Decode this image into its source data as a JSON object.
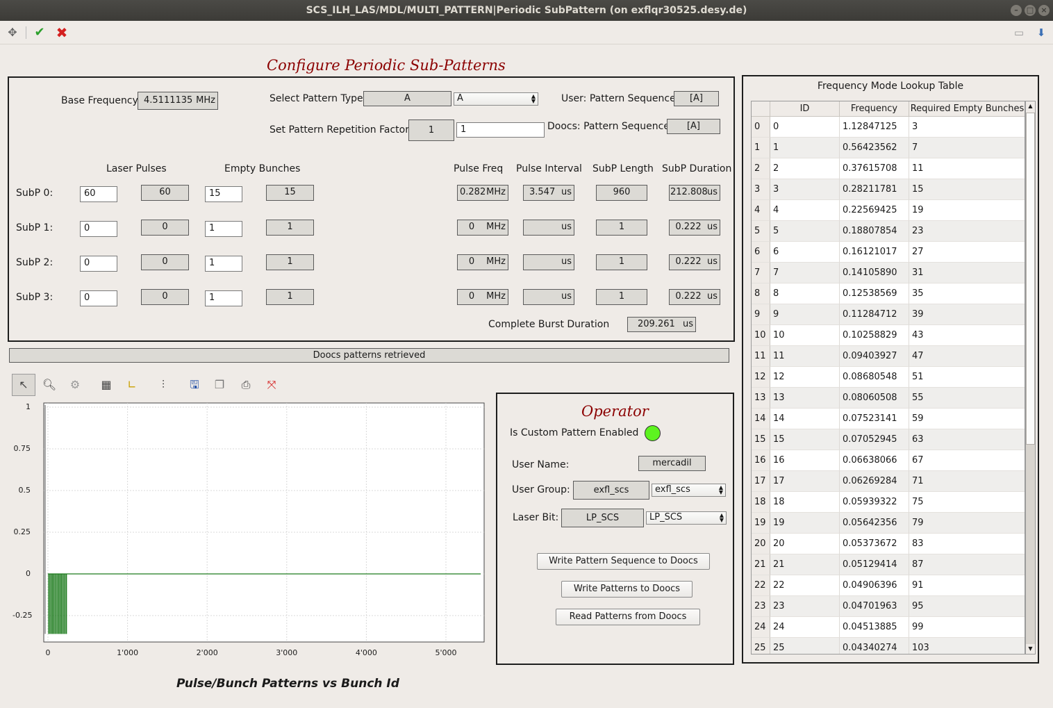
{
  "window": {
    "title": "SCS_ILH_LAS/MDL/MULTI_PATTERN|Periodic SubPattern (on exflqr30525.desy.de)"
  },
  "colors": {
    "title_red": "#8b0000",
    "led_on": "#5df31f",
    "pulse_green": "#1c7a1c"
  },
  "config": {
    "heading": "Configure Periodic Sub-Patterns",
    "base_freq_label": "Base Frequency",
    "base_freq_value": "4.5111135",
    "base_freq_unit": "MHz",
    "pattern_type_label": "Select Pattern Type",
    "pattern_type_value": "A",
    "pattern_type_selected": "A",
    "user_seq_label": "User: Pattern Sequence",
    "user_seq_value": "[A]",
    "rep_factor_label": "Set Pattern Repetition Factor",
    "rep_factor_value": "1",
    "rep_factor_input": "1",
    "doocs_seq_label": "Doocs: Pattern Sequence",
    "doocs_seq_value": "[A]",
    "headers": {
      "laser_pulses": "Laser Pulses",
      "empty_bunches": "Empty Bunches",
      "pulse_freq": "Pulse Freq",
      "pulse_interval": "Pulse Interval",
      "subp_length": "SubP Length",
      "subp_duration": "SubP Duration"
    },
    "subp": [
      {
        "label": "SubP 0:",
        "laser_in": "60",
        "laser_ro": "60",
        "empty_in": "15",
        "empty_ro": "15",
        "freq": "0.282",
        "freq_unit": "MHz",
        "interval": "3.547",
        "interval_unit": "us",
        "length": "960",
        "duration": "212.808",
        "duration_unit": "us"
      },
      {
        "label": "SubP 1:",
        "laser_in": "0",
        "laser_ro": "0",
        "empty_in": "1",
        "empty_ro": "1",
        "freq": "0",
        "freq_unit": "MHz",
        "interval": "",
        "interval_unit": "us",
        "length": "1",
        "duration": "0.222",
        "duration_unit": "us"
      },
      {
        "label": "SubP 2:",
        "laser_in": "0",
        "laser_ro": "0",
        "empty_in": "1",
        "empty_ro": "1",
        "freq": "0",
        "freq_unit": "MHz",
        "interval": "",
        "interval_unit": "us",
        "length": "1",
        "duration": "0.222",
        "duration_unit": "us"
      },
      {
        "label": "SubP 3:",
        "laser_in": "0",
        "laser_ro": "0",
        "empty_in": "1",
        "empty_ro": "1",
        "freq": "0",
        "freq_unit": "MHz",
        "interval": "",
        "interval_unit": "us",
        "length": "1",
        "duration": "0.222",
        "duration_unit": "us"
      }
    ],
    "burst_label": "Complete Burst Duration",
    "burst_value": "209.261",
    "burst_unit": "us"
  },
  "status": {
    "text": "Doocs patterns retrieved"
  },
  "operator": {
    "heading": "Operator",
    "custom_label": "Is Custom Pattern Enabled",
    "username_label": "User Name:",
    "username_value": "mercadil",
    "group_label": "User Group:",
    "group_value": "exfl_scs",
    "group_selected": "exfl_scs",
    "laserbit_label": "Laser Bit:",
    "laserbit_value": "LP_SCS",
    "laserbit_selected": "LP_SCS",
    "btn_write_seq": "Write Pattern Sequence to Doocs",
    "btn_write_patterns": "Write Patterns to Doocs",
    "btn_read_patterns": "Read Patterns from Doocs"
  },
  "lookup": {
    "title": "Frequency Mode Lookup Table",
    "columns": [
      "ID",
      "Frequency",
      "Required Empty Bunches"
    ],
    "rows": [
      [
        "0",
        "0",
        "1.12847125",
        "3"
      ],
      [
        "1",
        "1",
        "0.56423562",
        "7"
      ],
      [
        "2",
        "2",
        "0.37615708",
        "11"
      ],
      [
        "3",
        "3",
        "0.28211781",
        "15"
      ],
      [
        "4",
        "4",
        "0.22569425",
        "19"
      ],
      [
        "5",
        "5",
        "0.18807854",
        "23"
      ],
      [
        "6",
        "6",
        "0.16121017",
        "27"
      ],
      [
        "7",
        "7",
        "0.14105890",
        "31"
      ],
      [
        "8",
        "8",
        "0.12538569",
        "35"
      ],
      [
        "9",
        "9",
        "0.11284712",
        "39"
      ],
      [
        "10",
        "10",
        "0.10258829",
        "43"
      ],
      [
        "11",
        "11",
        "0.09403927",
        "47"
      ],
      [
        "12",
        "12",
        "0.08680548",
        "51"
      ],
      [
        "13",
        "13",
        "0.08060508",
        "55"
      ],
      [
        "14",
        "14",
        "0.07523141",
        "59"
      ],
      [
        "15",
        "15",
        "0.07052945",
        "63"
      ],
      [
        "16",
        "16",
        "0.06638066",
        "67"
      ],
      [
        "17",
        "17",
        "0.06269284",
        "71"
      ],
      [
        "18",
        "18",
        "0.05939322",
        "75"
      ],
      [
        "19",
        "19",
        "0.05642356",
        "79"
      ],
      [
        "20",
        "20",
        "0.05373672",
        "83"
      ],
      [
        "21",
        "21",
        "0.05129414",
        "87"
      ],
      [
        "22",
        "22",
        "0.04906396",
        "91"
      ],
      [
        "23",
        "23",
        "0.04701963",
        "95"
      ],
      [
        "24",
        "24",
        "0.04513885",
        "99"
      ],
      [
        "25",
        "25",
        "0.04340274",
        "103"
      ]
    ]
  },
  "chart_data": {
    "type": "line",
    "title": "Pulse/Bunch Patterns vs Bunch Id",
    "xlabel": "",
    "ylabel": "",
    "xlim": [
      0,
      5400
    ],
    "ylim": [
      -0.38,
      1.0
    ],
    "x_ticks": [
      "0",
      "1'000",
      "2'000",
      "3'000",
      "4'000",
      "5'000"
    ],
    "y_ticks": [
      "1",
      "0.75",
      "0.5",
      "0.25",
      "0",
      "-0.25"
    ],
    "grid": true,
    "pulse_train": {
      "start": 0,
      "count": 15,
      "spacing": 16,
      "low": -0.36,
      "baseline": 0
    }
  }
}
